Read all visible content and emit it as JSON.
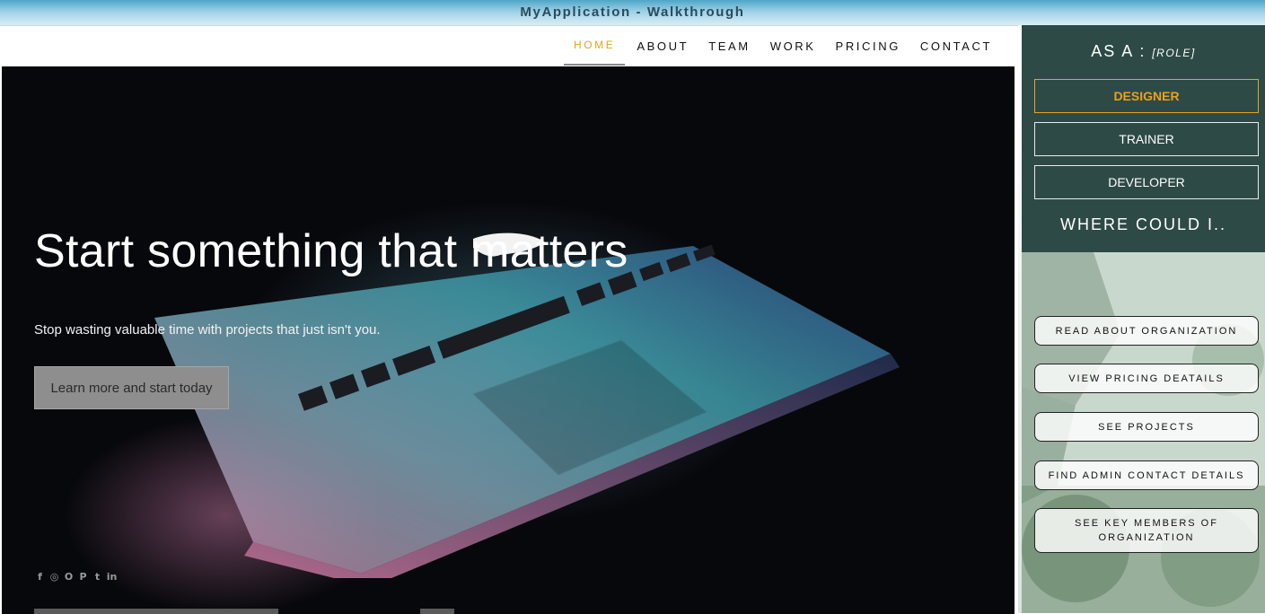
{
  "window": {
    "title": "MyApplication - Walkthrough"
  },
  "nav": {
    "items": [
      {
        "label": "HOME",
        "active": true
      },
      {
        "label": "ABOUT",
        "active": false
      },
      {
        "label": "TEAM",
        "active": false
      },
      {
        "label": "WORK",
        "active": false
      },
      {
        "label": "PRICING",
        "active": false
      },
      {
        "label": "CONTACT",
        "active": false
      }
    ],
    "accent_color": "#e8a21d"
  },
  "hero": {
    "title": "Start something that matters",
    "subtitle": "Stop wasting valuable time with projects that just isn't you.",
    "cta_label": "Learn more and start today",
    "social_icons": [
      "facebook-icon",
      "instagram-icon",
      "opera-icon",
      "pinterest-icon",
      "twitter-icon",
      "linkedin-icon"
    ]
  },
  "walkthrough": {
    "as_a_label": "AS A :",
    "role_placeholder": "[ROLE]",
    "roles": [
      {
        "label": "DESIGNER",
        "selected": true
      },
      {
        "label": "TRAINER",
        "selected": false
      },
      {
        "label": "DEVELOPER",
        "selected": false
      }
    ],
    "where_label": "WHERE COULD I..",
    "actions": [
      {
        "label": "READ ABOUT ORGANIZATION"
      },
      {
        "label": "VIEW PRICING DEATAILS"
      },
      {
        "label": "SEE PROJECTS"
      },
      {
        "label": "FIND ADMIN CONTACT DETAILS"
      },
      {
        "label": "SEE KEY MEMBERS OF ORGANIZATION"
      }
    ],
    "panel_color": "#2e4a46"
  }
}
